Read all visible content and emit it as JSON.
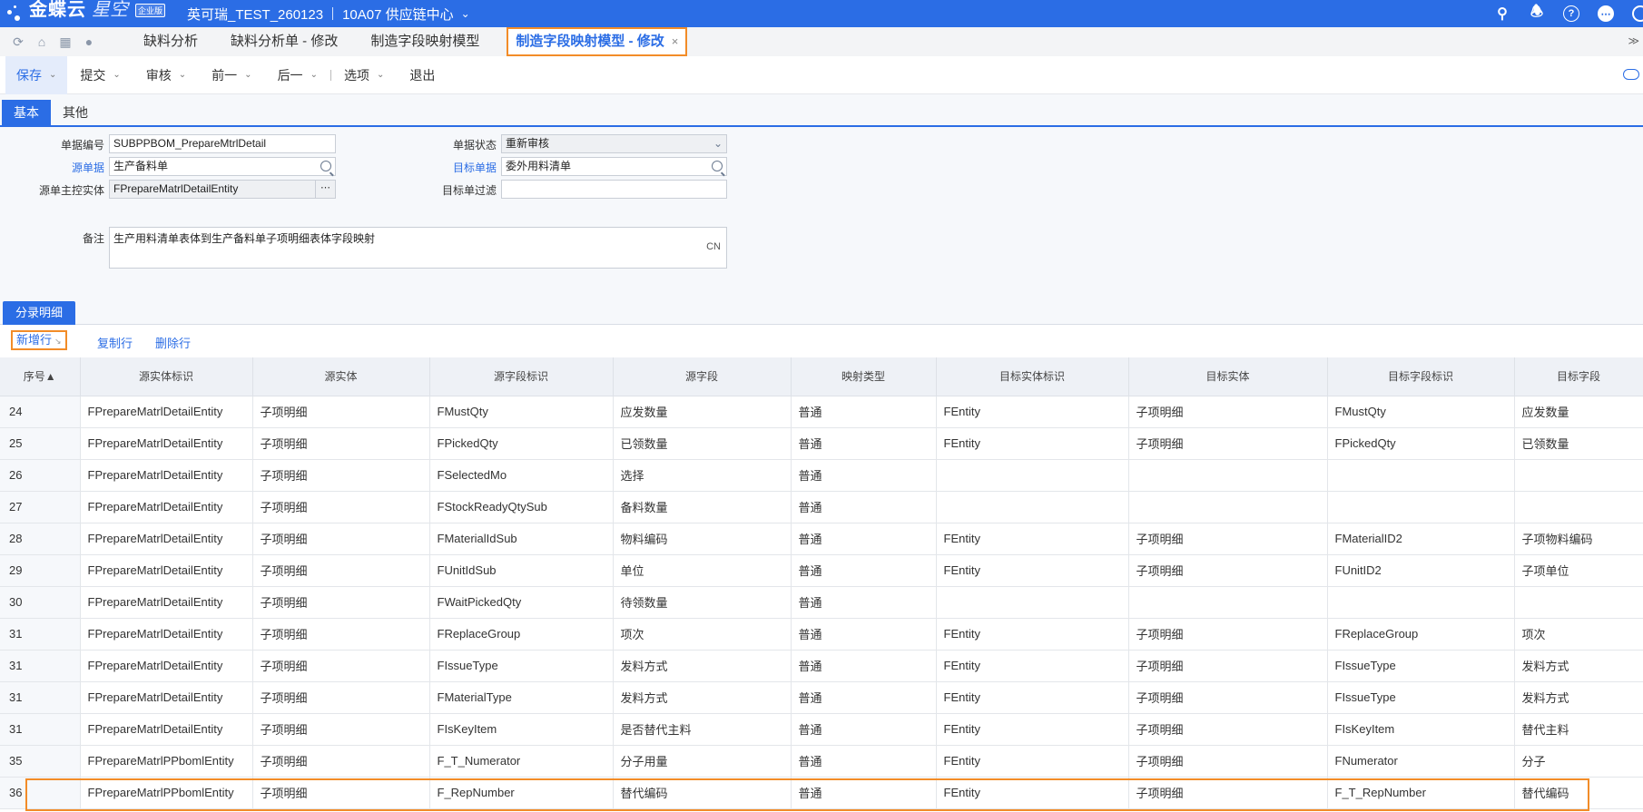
{
  "header": {
    "brand": "金蝶云",
    "brand_sub": "星空",
    "edition": "企业版",
    "tenant": "英可瑞_TEST_260123",
    "org": "10A07 供应链中心"
  },
  "tabs": [
    {
      "label": "缺料分析"
    },
    {
      "label": "缺料分析单 - 修改"
    },
    {
      "label": "制造字段映射模型"
    },
    {
      "label": "制造字段映射模型 - 修改"
    }
  ],
  "toolbar": {
    "save": "保存",
    "submit": "提交",
    "audit": "审核",
    "prev": "前一",
    "next": "后一",
    "options": "选项",
    "exit": "退出"
  },
  "subtabs": {
    "basic": "基本",
    "other": "其他"
  },
  "form": {
    "bill_no_label": "单据编号",
    "bill_no": "SUBPPBOM_PrepareMtrlDetail",
    "status_label": "单据状态",
    "status": "重新审核",
    "source_bill_label": "源单据",
    "source_bill": "生产备料单",
    "target_bill_label": "目标单据",
    "target_bill": "委外用料清单",
    "source_entity_label": "源单主控实体",
    "source_entity": "FPrepareMatrlDetailEntity",
    "target_filter_label": "目标单过滤",
    "target_filter": "",
    "remark_label": "备注",
    "remark": "生产用料清单表体到生产备料单子项明细表体字段映射",
    "remark_lang": "CN"
  },
  "entry": {
    "tab": "分录明细",
    "new_row": "新增行",
    "copy_row": "复制行",
    "delete_row": "删除行"
  },
  "grid": {
    "columns": [
      "序号▲",
      "源实体标识",
      "源实体",
      "源字段标识",
      "源字段",
      "映射类型",
      "目标实体标识",
      "目标实体",
      "目标字段标识",
      "目标字段"
    ],
    "rows": [
      [
        "24",
        "FPrepareMatrlDetailEntity",
        "子项明细",
        "FMustQty",
        "应发数量",
        "普通",
        "FEntity",
        "子项明细",
        "FMustQty",
        "应发数量"
      ],
      [
        "25",
        "FPrepareMatrlDetailEntity",
        "子项明细",
        "FPickedQty",
        "已领数量",
        "普通",
        "FEntity",
        "子项明细",
        "FPickedQty",
        "已领数量"
      ],
      [
        "26",
        "FPrepareMatrlDetailEntity",
        "子项明细",
        "FSelectedMo",
        "选择",
        "普通",
        "",
        "",
        "",
        ""
      ],
      [
        "27",
        "FPrepareMatrlDetailEntity",
        "子项明细",
        "FStockReadyQtySub",
        "备料数量",
        "普通",
        "",
        "",
        "",
        ""
      ],
      [
        "28",
        "FPrepareMatrlDetailEntity",
        "子项明细",
        "FMaterialIdSub",
        "物料编码",
        "普通",
        "FEntity",
        "子项明细",
        "FMaterialID2",
        "子项物料编码"
      ],
      [
        "29",
        "FPrepareMatrlDetailEntity",
        "子项明细",
        "FUnitIdSub",
        "单位",
        "普通",
        "FEntity",
        "子项明细",
        "FUnitID2",
        "子项单位"
      ],
      [
        "30",
        "FPrepareMatrlDetailEntity",
        "子项明细",
        "FWaitPickedQty",
        "待领数量",
        "普通",
        "",
        "",
        "",
        ""
      ],
      [
        "31",
        "FPrepareMatrlDetailEntity",
        "子项明细",
        "FReplaceGroup",
        "项次",
        "普通",
        "FEntity",
        "子项明细",
        "FReplaceGroup",
        "项次"
      ],
      [
        "31",
        "FPrepareMatrlDetailEntity",
        "子项明细",
        "FIssueType",
        "发料方式",
        "普通",
        "FEntity",
        "子项明细",
        "FIssueType",
        "发料方式"
      ],
      [
        "31",
        "FPrepareMatrlDetailEntity",
        "子项明细",
        "FMaterialType",
        "发料方式",
        "普通",
        "FEntity",
        "子项明细",
        "FIssueType",
        "发料方式"
      ],
      [
        "31",
        "FPrepareMatrlDetailEntity",
        "子项明细",
        "FIsKeyItem",
        "是否替代主料",
        "普通",
        "FEntity",
        "子项明细",
        "FIsKeyItem",
        "替代主料"
      ],
      [
        "35",
        "FPrepareMatrlPPbomlEntity",
        "子项明细",
        "F_T_Numerator",
        "分子用量",
        "普通",
        "FEntity",
        "子项明细",
        "FNumerator",
        "分子"
      ],
      [
        "36",
        "FPrepareMatrlPPbomlEntity",
        "子项明细",
        "F_RepNumber",
        "替代编码",
        "普通",
        "FEntity",
        "子项明细",
        "F_T_RepNumber",
        "替代编码"
      ]
    ]
  },
  "colors": {
    "brand": "#2b6de5",
    "highlight": "#f28c28"
  },
  "icons": [
    "search-icon",
    "bell-icon",
    "help-icon",
    "message-icon",
    "user-icon",
    "home-icon",
    "apps-icon",
    "chat-icon",
    "refresh-icon",
    "cloud-icon"
  ]
}
